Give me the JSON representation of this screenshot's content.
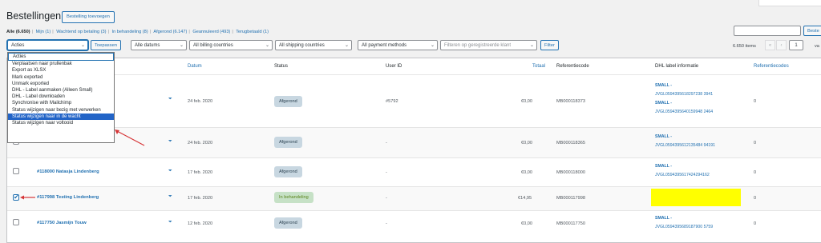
{
  "header": {
    "title": "Bestellingen",
    "add_button": "Bestelling toevoegen"
  },
  "filters": {
    "status_links": [
      {
        "label": "Alle (6.650)",
        "current": true
      },
      {
        "label": "Mijn (1)"
      },
      {
        "label": "Wachtend op betaling (3)"
      },
      {
        "label": "In behandeling (8)"
      },
      {
        "label": "Afgerond (6.147)"
      },
      {
        "label": "Geannuleerd (493)"
      },
      {
        "label": "Terugbetaald (1)"
      }
    ],
    "bulk_select": "Acties",
    "apply_button": "Toepassen",
    "dates_select": "Alle datums",
    "billing_select": "All billing countries",
    "shipping_select": "All shipping countries",
    "payment_select": "All payment methods",
    "customer_placeholder": "Filteren op geregistreerde klant",
    "filter_button": "Filter",
    "search_button": "Beste"
  },
  "pagination": {
    "items": "6.650 items",
    "first": "«",
    "prev": "‹",
    "current_page": "1",
    "of": "va"
  },
  "bulk_options": [
    "Acties",
    "Verplaatsen naar prullenbak",
    "Export as XLSX",
    "Mark exported",
    "Unmark exported",
    "DHL - Label aanmaken (Alleen Small)",
    "DHL - Label downloaden",
    "Synchronise with Mailchimp",
    "Status wijzigen naar bezig met verwerken",
    "Status wijzigen naar in de wacht",
    "Status wijzigen naar voltooid"
  ],
  "highlighted_option_index": 9,
  "columns": {
    "datum": "Datum",
    "status": "Status",
    "user_id": "User ID",
    "totaal": "Totaal",
    "referentiecode": "Referentiecode",
    "dhl": "DHL label informatie",
    "referentiecodes": "Referentiecodes"
  },
  "rows": [
    {
      "order": "",
      "date": "24 feb. 2020",
      "status": "Afgerond",
      "status_type": "done",
      "user": "#5792",
      "total": "€0,00",
      "ref": "MB000118373",
      "dhl_title": "SMALL -",
      "dhl_codes": [
        "JVGL0594395618297238 3941",
        "SMALL -",
        "JVGL0594395640159948 2464"
      ],
      "refs": "0",
      "checked": false
    },
    {
      "order": "",
      "date": "24 feb. 2020",
      "status": "Afgerond",
      "status_type": "done",
      "user": "-",
      "total": "€0,00",
      "ref": "MB000118365",
      "dhl_title": "SMALL -",
      "dhl_codes": [
        "JVGL0594395612135484 94191"
      ],
      "refs": "0",
      "checked": false
    },
    {
      "order": "#118000 Natasja Lindenberg",
      "date": "17 feb. 2020",
      "status": "Afgerond",
      "status_type": "done",
      "user": "-",
      "total": "€0,00",
      "ref": "MB000118000",
      "dhl_title": "SMALL -",
      "dhl_codes": [
        "JVGL0594395617424294162"
      ],
      "refs": "0",
      "checked": false
    },
    {
      "order": "#117998 Testing Lindenberg",
      "date": "17 feb. 2020",
      "status": "In behandeling",
      "status_type": "proc",
      "user": "-",
      "total": "€14,95",
      "ref": "MB000117998",
      "dhl_title": "",
      "dhl_codes": [],
      "refs": "0",
      "checked": true
    },
    {
      "order": "#117750 Jasmijn Touw",
      "date": "12 feb. 2020",
      "status": "Afgerond",
      "status_type": "done",
      "user": "-",
      "total": "€0,00",
      "ref": "MB000117750",
      "dhl_title": "SMALL -",
      "dhl_codes": [
        "JVGL0594395689187900 5759"
      ],
      "refs": "0",
      "checked": false
    }
  ],
  "colors": {
    "accent": "#2271b1",
    "highlight": "#ffff00",
    "selected_option": "#2264c7",
    "arrow": "#d63638"
  }
}
